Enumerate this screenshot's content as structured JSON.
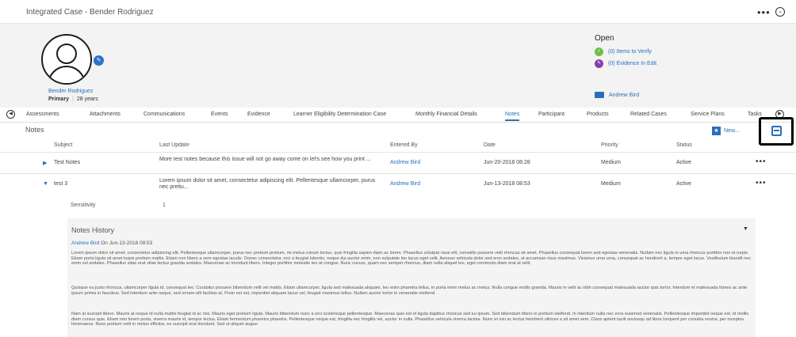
{
  "app": {
    "title": "Integrated Case - Bender Rodriguez",
    "more": "•••",
    "collapse": "⌄"
  },
  "person": {
    "name": "Bender Rodriguez",
    "role": "Primary",
    "age": "28 years",
    "edit": "✎"
  },
  "case_status": {
    "status": "Open",
    "items_to_verify": "(0) Items to Verify",
    "evidence_in_edit": "(0) Evidence In Edit",
    "owner": "Andrew Bird",
    "colors": {
      "verify": "#6cc04a",
      "evidence": "#8a3fa8",
      "link": "#2a6ebb"
    }
  },
  "tabs": [
    {
      "label": "Assessments"
    },
    {
      "label": "Attachments"
    },
    {
      "label": "Communications"
    },
    {
      "label": "Events"
    },
    {
      "label": "Evidence"
    },
    {
      "label": "Learner Eligibility Determination Case"
    },
    {
      "label": "Monthly Financial Details"
    },
    {
      "label": "Notes",
      "active": true
    },
    {
      "label": "Participant"
    },
    {
      "label": "Products"
    },
    {
      "label": "Related Cases"
    },
    {
      "label": "Service Plans"
    },
    {
      "label": "Tasks"
    }
  ],
  "notes": {
    "title": "Notes",
    "new_label": "New...",
    "columns": {
      "subject": "Subject",
      "last_update": "Last Update",
      "entered_by": "Entered By",
      "date": "Date",
      "priority": "Priority",
      "status": "Status"
    },
    "rows": [
      {
        "toggle": "▶",
        "subject": "Test Notes",
        "last_update": "More test notes because this issue will not go away come on let's see how you print ...",
        "entered_by": "Andrew Bird",
        "date": "Jun-20-2018 08:28",
        "priority": "Medium",
        "status": "Active",
        "more": "•••"
      },
      {
        "toggle": "▼",
        "subject": "test 3",
        "last_update": "Lorem ipsum dolor sit amet, consectetur adipiscing elit. Pellentesque ullamcorper, purus nec pretiu...",
        "entered_by": "Andrew Bird",
        "date": "Jun-13-2018 08:53",
        "priority": "Medium",
        "status": "Active",
        "more": "•••"
      }
    ],
    "sensitivity_label": "Sensitivity",
    "sensitivity_value": "1"
  },
  "history": {
    "title": "Notes History",
    "caret": "▼",
    "author": "Andrew Bird",
    "on": "On",
    "date": "Jun-13-2018 08:53",
    "paragraphs": [
      "Lorem ipsum dolor sit amet, consectetur adipiscing elit. Pellentesque ullamcorper, purus nec pretium pretium, mi metus rutrum lectus, quis fringilla sapien diam ac lorem. Phasellus volutpat risus elit, convallis posuere velit rhoncus sit amet. Phasellus consequat lorem sed egestas venenatis. Nullam nec ligula in urna rhoncus porttitor non et turpis. Etiam porta ligula sit amet turpis pretium mattis. Etiam non libero a sem egestas iaculis. Donec consectetur, orci a feugiat lobortis, neque dui auctor enim, non vulputate leo lacus eget velit. Aenean vehicula dolor sed eros sodales, ut accumsan risus maximus. Vivamus urna urna, consequat ac hendrerit a, tempor eget lacus. Vestibulum blandit nec enim vel sodales. Phasellus vitae erat vitae lectus gravida sodales. Maecenas ac tincidunt libero. Integer porttitor molestie leo at congue. Nunc cursus, quam nec semper rhoncus, diam nulla aliquet leo, eget commodo diam erat at velit.",
      "Quisque eu justo rhoncus, ullamcorper ligula id, consequat leo. Curabitur posuere bibendum velit vel mattis. Etiam ullamcorper, ligula sed malesuada aliquam, leo enim pharetra tellus, in porta enim metus ac metus. Nulla congue mollis gravida. Mauris in velit ac nibh consequat malesuada auctor quis tortor. Interdum et malesuada fames ac ante ipsum primis in faucibus. Sed interdum ante neque, sed ornare elit facilisis at. Proin est est, imperdiet aliquam lacus vel, feugiat maximus tellus. Nullam auctor tortor in venenatis eleifend.",
      "Nam at suscipit libero. Mauris at neque id nulla mattis feugiat id ac nisi. Mauris eget pretium ligula. Mauris bibendum nunc a orci scelerisque pellentesque. Maecenas quis est et ligula dapibus rhoncus sed eu ipsum. Sed bibendum libero in pretium eleifend. In interdum nulla nec eros euismod venenatis. Pellentesque imperdiet neque est, id mollis diam cursus quis. Etiam non lorem porta, viverra mauris id, tempor lectus. Etiam fermentum pharetra pharetra. Pellentesque neque est, fringilla nec fringilla vel, auctor in nulla. Phasellus vehicula viverra lacinia. Nunc et nisi ac lectus hendrerit ultrices a sit amet sem. Class aptent taciti sociosqu ad litora torquent per conubia nostra, per inceptos himenaeos. Nunc pretium velit in metus efficitur, eu suscipit erat tincidunt. Sed ut aliquet augue."
    ]
  }
}
